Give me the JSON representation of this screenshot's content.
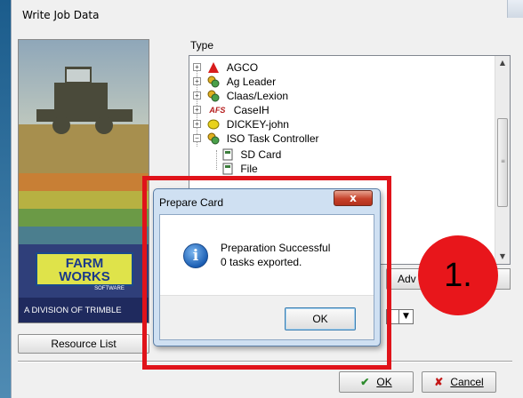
{
  "dialog": {
    "title": "Write Job Data",
    "type_label": "Type",
    "resource_list_label": "Resource List",
    "ok_label": "OK",
    "cancel_label": "Cancel",
    "advanced_label": "Adv"
  },
  "logo": {
    "brand_line1": "FARM",
    "brand_line2": "WORKS",
    "brand_sub": "SOFTWARE",
    "division_text": "A DIVISION OF TRIMBLE"
  },
  "tree": {
    "items": [
      {
        "label": "AGCO",
        "icon": "agco-logo-icon",
        "expander": "+"
      },
      {
        "label": "Ag Leader",
        "icon": "gear-icon",
        "expander": "+"
      },
      {
        "label": "Claas/Lexion",
        "icon": "gear-icon",
        "expander": "+"
      },
      {
        "label": "CaseIH",
        "icon": "afs-logo-icon",
        "expander": "+",
        "icon_text": "AFS"
      },
      {
        "label": "DICKEY-john",
        "icon": "yellow-logo-icon",
        "expander": "+"
      },
      {
        "label": "ISO Task Controller",
        "icon": "gear-icon",
        "expander": "−"
      },
      {
        "label": "SD Card",
        "icon": "card-icon"
      },
      {
        "label": "File",
        "icon": "card-icon"
      }
    ]
  },
  "popup": {
    "title": "Prepare Card",
    "close_label": "x",
    "message_line1": "Preparation Successful",
    "message_line2": "0 tasks exported.",
    "ok_label": "OK",
    "icon": "info-icon"
  },
  "annotation": {
    "step_label": "1."
  },
  "colors": {
    "highlight": "#e0131a",
    "step_circle": "#e8161b",
    "popup_frame": "#cfe0f2"
  }
}
